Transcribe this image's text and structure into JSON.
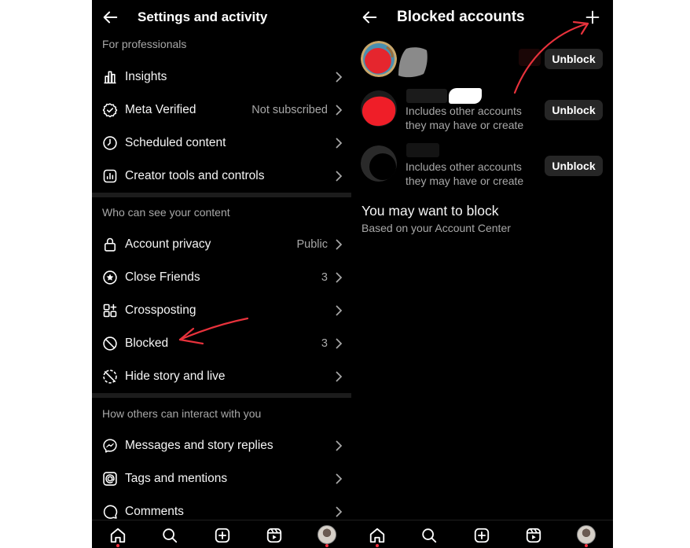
{
  "settings": {
    "title": "Settings and activity",
    "sections": [
      {
        "title": "For professionals",
        "items": [
          {
            "label": "Insights",
            "value": "",
            "icon": "insights-icon"
          },
          {
            "label": "Meta Verified",
            "value": "Not subscribed",
            "icon": "verified-badge-icon"
          },
          {
            "label": "Scheduled content",
            "value": "",
            "icon": "clock-icon"
          },
          {
            "label": "Creator tools and controls",
            "value": "",
            "icon": "creator-tools-icon"
          }
        ]
      },
      {
        "title": "Who can see your content",
        "items": [
          {
            "label": "Account privacy",
            "value": "Public",
            "icon": "lock-icon"
          },
          {
            "label": "Close Friends",
            "value": "3",
            "icon": "star-circle-icon"
          },
          {
            "label": "Crossposting",
            "value": "",
            "icon": "crossposting-icon"
          },
          {
            "label": "Blocked",
            "value": "3",
            "icon": "blocked-icon"
          },
          {
            "label": "Hide story and live",
            "value": "",
            "icon": "hide-story-icon"
          }
        ]
      },
      {
        "title": "How others can interact with you",
        "items": [
          {
            "label": "Messages and story replies",
            "value": "",
            "icon": "messenger-icon"
          },
          {
            "label": "Tags and mentions",
            "value": "",
            "icon": "at-sign-icon"
          },
          {
            "label": "Comments",
            "value": "",
            "icon": "comment-icon"
          }
        ]
      }
    ]
  },
  "blocked": {
    "title": "Blocked accounts",
    "unblock_label": "Unblock",
    "accounts": [
      {
        "note": ""
      },
      {
        "note": "Includes other accounts\nthey may have or create"
      },
      {
        "note": "Includes other accounts\nthey may have or create"
      }
    ],
    "suggest_title": "You may want to block",
    "suggest_subtitle": "Based on your Account Center"
  },
  "nav_icons": [
    "home-icon",
    "search-icon",
    "create-icon",
    "reels-icon",
    "profile-avatar"
  ],
  "colors": {
    "background": "#000000",
    "text": "#f5f5f5",
    "secondary_text": "#a8a8a8",
    "button": "#262626",
    "annotation_arrow": "#e8323c"
  }
}
